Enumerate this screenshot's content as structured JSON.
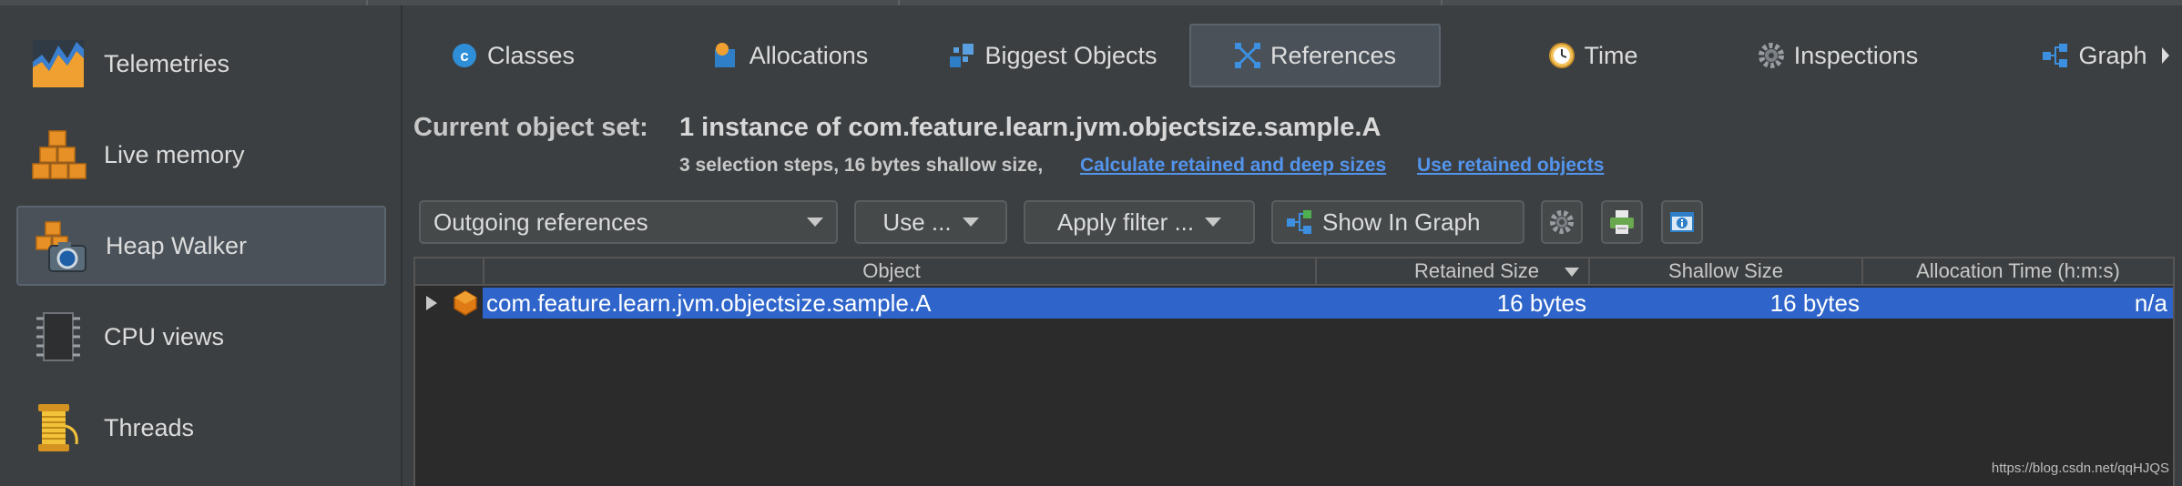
{
  "sidebar": {
    "items": [
      {
        "label": "Telemetries",
        "icon": "telemetries-icon",
        "active": false
      },
      {
        "label": "Live memory",
        "icon": "live-memory-icon",
        "active": false
      },
      {
        "label": "Heap Walker",
        "icon": "heap-walker-icon",
        "active": true
      },
      {
        "label": "CPU views",
        "icon": "cpu-views-icon",
        "active": false
      },
      {
        "label": "Threads",
        "icon": "threads-icon",
        "active": false
      }
    ]
  },
  "tabs": [
    {
      "label": "Classes",
      "icon": "classes-icon"
    },
    {
      "label": "Allocations",
      "icon": "allocations-icon"
    },
    {
      "label": "Biggest Objects",
      "icon": "biggest-objects-icon"
    },
    {
      "label": "References",
      "icon": "references-icon",
      "active": true
    },
    {
      "label": "Time",
      "icon": "time-icon"
    },
    {
      "label": "Inspections",
      "icon": "inspections-icon"
    },
    {
      "label": "Graph",
      "icon": "graph-icon"
    }
  ],
  "current": {
    "label": "Current object set:",
    "value": "1 instance of com.feature.learn.jvm.objectsize.sample.A",
    "info": "3 selection steps, 16 bytes shallow size,",
    "link1": "Calculate retained and deep sizes",
    "link2": "Use retained objects"
  },
  "toolbar": {
    "reference_mode": "Outgoing references",
    "use_label": "Use ...",
    "apply_filter_label": "Apply filter ...",
    "show_in_graph_label": "Show In Graph"
  },
  "table": {
    "columns": [
      "Object",
      "Retained Size",
      "Shallow Size",
      "Allocation Time (h:m:s)"
    ],
    "rows": [
      {
        "object": "com.feature.learn.jvm.objectsize.sample.A",
        "retained": "16 bytes",
        "shallow": "16 bytes",
        "alloc_time": "n/a"
      }
    ]
  },
  "watermark": "https://blog.csdn.net/qqHJQS",
  "colors": {
    "background": "#3c3f41",
    "selection": "#2f65ca",
    "link": "#5394ec"
  }
}
